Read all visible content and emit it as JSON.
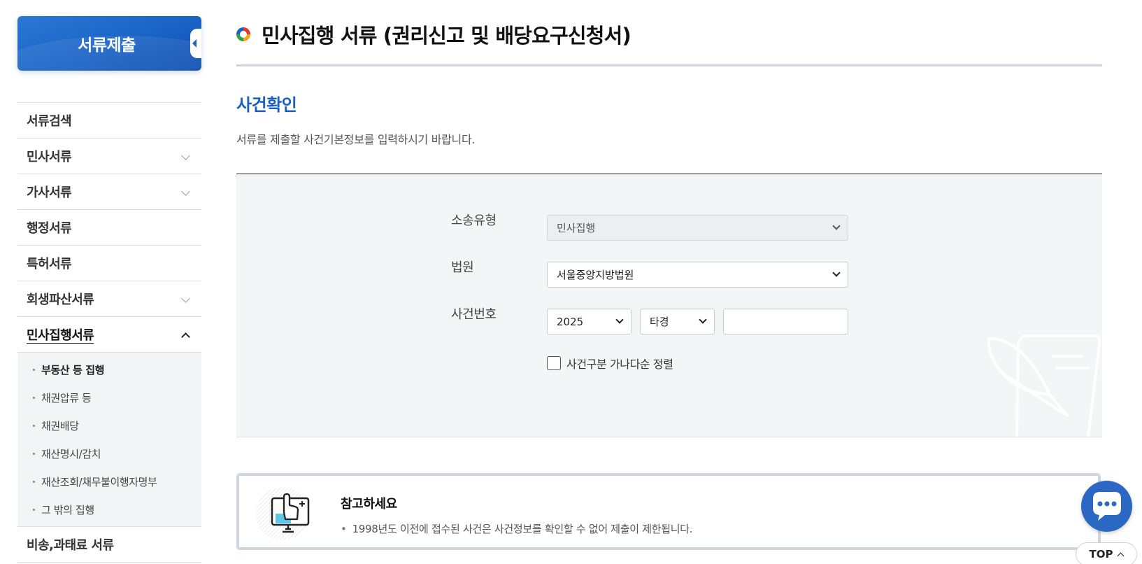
{
  "sidebar": {
    "title": "서류제출",
    "items": [
      {
        "label": "서류검색",
        "has_children": false
      },
      {
        "label": "민사서류",
        "has_children": true
      },
      {
        "label": "가사서류",
        "has_children": true
      },
      {
        "label": "행정서류",
        "has_children": false
      },
      {
        "label": "특허서류",
        "has_children": false
      },
      {
        "label": "회생파산서류",
        "has_children": true
      },
      {
        "label": "민사집행서류",
        "has_children": true,
        "expanded": true
      },
      {
        "label": "비송,과태료 서류",
        "has_children": false
      }
    ],
    "subitems": [
      {
        "label": "부동산 등 집행",
        "current": true
      },
      {
        "label": "채권압류 등"
      },
      {
        "label": "채권배당"
      },
      {
        "label": "재산명시/감치"
      },
      {
        "label": "재산조회/채무불이행자명부"
      },
      {
        "label": "그 밖의 집행"
      }
    ]
  },
  "page": {
    "title": "민사집행 서류 (권리신고 및 배당요구신청서)",
    "section_title": "사건확인",
    "section_desc": "서류를 제출할 사건기본정보를 입력하시기 바랍니다."
  },
  "form": {
    "lawsuit_type_label": "소송유형",
    "lawsuit_type_value": "민사집행",
    "court_label": "법원",
    "court_value": "서울중앙지방법원",
    "case_number_label": "사건번호",
    "case_year_value": "2025",
    "case_type_value": "타경",
    "case_number_value": "",
    "sort_checkbox_label": "사건구분 가나다순 정렬",
    "sort_checked": false
  },
  "notice": {
    "title": "참고하세요",
    "text": "1998년도 이전에 접수된 사건은 사건정보를 확인할 수 없어 제출이 제한됩니다."
  },
  "floating": {
    "top_label": "TOP",
    "chat_icon": "chat-bubble-icon"
  },
  "colors": {
    "brand_blue": "#1a63c6",
    "section_title_blue": "#1a5fc0",
    "chat_blue": "#2a68c4"
  }
}
